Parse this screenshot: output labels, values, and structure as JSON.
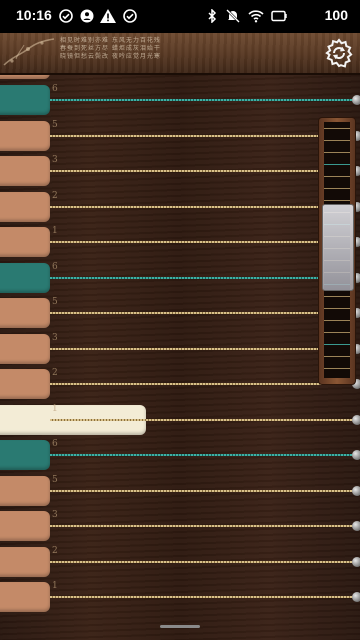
{
  "status_bar": {
    "time": "10:16",
    "battery": "100",
    "left_icons": [
      "check-circle-icon",
      "user-circle-icon",
      "warning-icon",
      "check-circle-icon"
    ],
    "right_icons": [
      "bluetooth-icon",
      "mute-icon",
      "wifi-icon",
      "battery-icon"
    ]
  },
  "header": {
    "settings_icon": "gear-refresh-icon",
    "calligraphy_lines": [
      "相见时难别亦难 东风无力百花残",
      "春蚕到死丝方尽 蜡炬成灰泪始干",
      "晓镜但愁云鬓改 夜吟应觉月光寒"
    ]
  },
  "colors": {
    "key": "#c48a68",
    "key_teal": "#2a7a72",
    "key_active": "#f3ecd6",
    "string_gold": "#d8c08a",
    "string_teal": "#3fb0a4"
  },
  "strings": [
    {
      "key_type": "teal",
      "active": false,
      "label": "6"
    },
    {
      "key_type": "normal",
      "active": false,
      "label": "5"
    },
    {
      "key_type": "normal",
      "active": false,
      "label": "3"
    },
    {
      "key_type": "normal",
      "active": false,
      "label": "2"
    },
    {
      "key_type": "normal",
      "active": false,
      "label": "1"
    },
    {
      "key_type": "teal",
      "active": false,
      "label": "6"
    },
    {
      "key_type": "normal",
      "active": false,
      "label": "5"
    },
    {
      "key_type": "normal",
      "active": false,
      "label": "3"
    },
    {
      "key_type": "normal",
      "active": false,
      "label": "2"
    },
    {
      "key_type": "normal",
      "active": true,
      "label": "1"
    },
    {
      "key_type": "teal",
      "active": false,
      "label": "6"
    },
    {
      "key_type": "normal",
      "active": false,
      "label": "5"
    },
    {
      "key_type": "normal",
      "active": false,
      "label": "3"
    },
    {
      "key_type": "normal",
      "active": false,
      "label": "2"
    },
    {
      "key_type": "normal",
      "active": false,
      "label": "1"
    }
  ],
  "scroll_thumb_position": 0.35
}
